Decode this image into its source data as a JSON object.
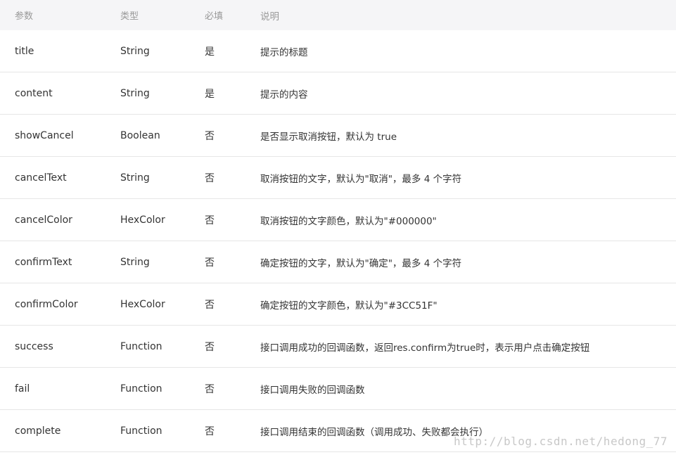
{
  "table": {
    "headers": [
      "参数",
      "类型",
      "必填",
      "说明"
    ],
    "rows": [
      [
        "title",
        "String",
        "是",
        "提示的标题"
      ],
      [
        "content",
        "String",
        "是",
        "提示的内容"
      ],
      [
        "showCancel",
        "Boolean",
        "否",
        "是否显示取消按钮，默认为 true"
      ],
      [
        "cancelText",
        "String",
        "否",
        "取消按钮的文字，默认为\"取消\"，最多 4 个字符"
      ],
      [
        "cancelColor",
        "HexColor",
        "否",
        "取消按钮的文字颜色，默认为\"#000000\""
      ],
      [
        "confirmText",
        "String",
        "否",
        "确定按钮的文字，默认为\"确定\"，最多 4 个字符"
      ],
      [
        "confirmColor",
        "HexColor",
        "否",
        "确定按钮的文字颜色，默认为\"#3CC51F\""
      ],
      [
        "success",
        "Function",
        "否",
        "接口调用成功的回调函数，返回res.confirm为true时，表示用户点击确定按钮"
      ],
      [
        "fail",
        "Function",
        "否",
        "接口调用失败的回调函数"
      ],
      [
        "complete",
        "Function",
        "否",
        "接口调用结束的回调函数（调用成功、失败都会执行）"
      ]
    ]
  },
  "watermark": "http://blog.csdn.net/hedong_77",
  "colors": {
    "header_bg": "#f5f5f7",
    "header_text": "#999999",
    "body_text": "#333333",
    "divider": "#e6e6e6",
    "watermark": "#c8c8c8"
  }
}
